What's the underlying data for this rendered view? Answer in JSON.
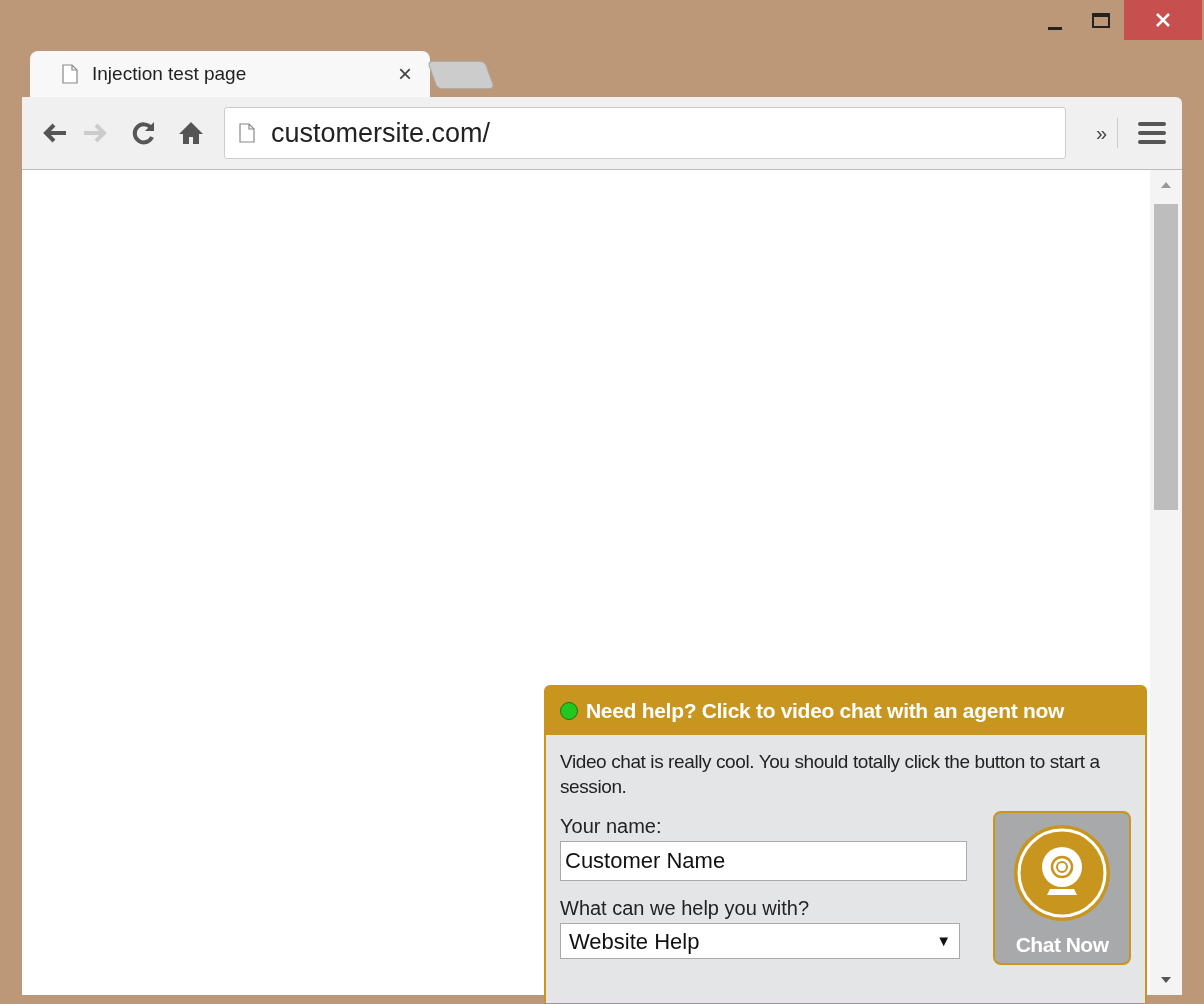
{
  "tabs": [
    {
      "title": "Injection test page",
      "close": "×",
      "selected": true
    }
  ],
  "toolbar": {
    "address": "customersite.com/",
    "forward_disabled": true,
    "extensions": "»"
  },
  "chat_widget": {
    "online": true,
    "header": "Need help? Click to video chat with an agent now",
    "description": "Video chat is really cool. You should totally click the button to start a session.",
    "name_label": "Your name:",
    "name_value": "Customer Name",
    "topic_label": "What can we help you with?",
    "topic_value": "Website Help",
    "topic_arrow": "▼",
    "button": "Chat Now"
  }
}
